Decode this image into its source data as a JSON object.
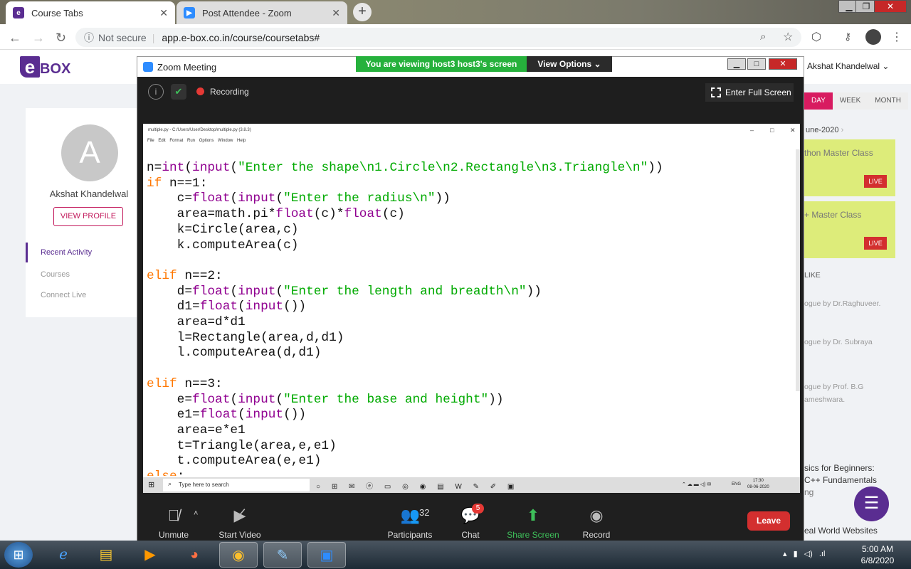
{
  "browser": {
    "tabs": [
      {
        "title": "Course Tabs",
        "icon": "ebox-favicon",
        "icon_color": "#5a2d91"
      },
      {
        "title": "Post Attendee - Zoom",
        "icon": "zoom-favicon",
        "icon_color": "#2d8cff"
      }
    ],
    "new_tab": "+",
    "security": "Not secure",
    "url": "app.e-box.co.in/course/coursetabs#"
  },
  "ebox": {
    "logo": "BOX",
    "logo_e": "e",
    "user_initial": "A",
    "user_name": "Akshat Khandelwal",
    "view_profile": "VIEW PROFILE",
    "nav": [
      "Recent Activity",
      "Courses",
      "Connect Live"
    ],
    "header_user": "Akshat Khandelwal",
    "calendar_buttons": [
      "DAY",
      "WEEK",
      "MONTH"
    ],
    "date_label": "une-2020",
    "cards": [
      {
        "title": "thon Master Class",
        "badge": "LIVE"
      },
      {
        "title": "+ Master Class",
        "badge": "LIVE"
      }
    ],
    "section_label": "LIKE",
    "blogs": [
      "ogue by Dr.Raghuveer.",
      "ogue by Dr. Subraya",
      "ogue by Prof. B.G",
      "ameshwara."
    ],
    "courses": [
      "sics for Beginners:",
      "C++ Fundamentals",
      "ng",
      "eal World Websites"
    ],
    "brand_color": "#5a2d91",
    "accent_color": "#d81b60"
  },
  "zoom": {
    "window_title": "Zoom Meeting",
    "viewing_banner": "You are viewing host3 host3's screen",
    "view_options": "View Options",
    "recording": "Recording",
    "full_screen": "Enter Full Screen",
    "controls": {
      "unmute": "Unmute",
      "start_video": "Start Video",
      "participants": "Participants",
      "participants_count": "32",
      "chat": "Chat",
      "chat_badge": "5",
      "share_screen": "Share Screen",
      "record": "Record",
      "leave": "Leave"
    }
  },
  "shared_screen": {
    "idle_title": "multiple.py - C:/Users/User/Desktop/multiple.py (3.8.3)",
    "idle_menu": "File Edit Format Run Options Window Help",
    "code_lines": [
      "n=int(input(\"Enter the shape\\n1.Circle\\n2.Rectangle\\n3.Triangle\\n\"))",
      "if n==1:",
      "    c=float(input(\"Enter the radius\\n\"))",
      "    area=math.pi*float(c)*float(c)",
      "    k=Circle(area,c)",
      "    k.computeArea(c)",
      "",
      "elif n==2:",
      "    d=float(input(\"Enter the length and breadth\\n\"))",
      "    d1=float(input())",
      "    area=d*d1",
      "    l=Rectangle(area,d,d1)",
      "    l.computeArea(d,d1)",
      "",
      "elif n==3:",
      "    e=float(input(\"Enter the base and height\"))",
      "    e1=float(input())",
      "    area=e*e1",
      "    t=Triangle(area,e,e1)",
      "    t.computeArea(e,e1)",
      "else:"
    ],
    "search_placeholder": "Type here to search",
    "lang": "ENG",
    "time": "17:30",
    "date": "08-06-2020"
  },
  "taskbar": {
    "time": "5:00 AM",
    "date": "6/8/2020"
  }
}
